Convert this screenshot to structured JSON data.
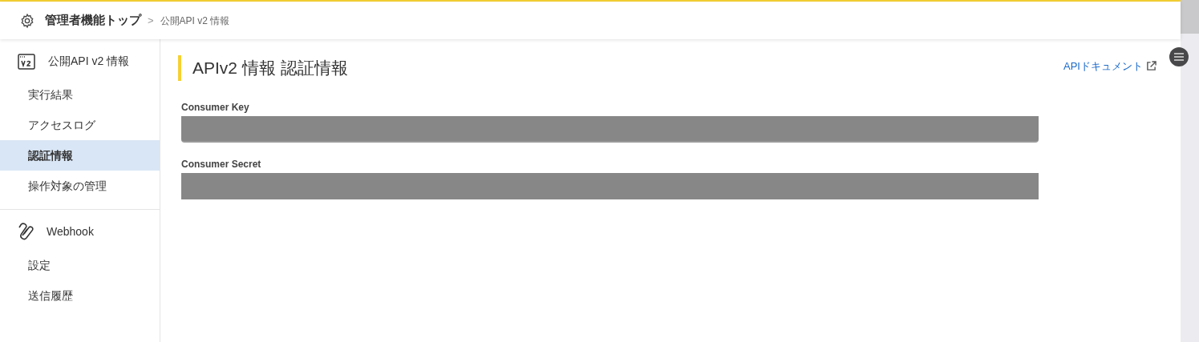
{
  "breadcrumb": {
    "home": "管理者機能トップ",
    "separator": ">",
    "current": "公開API v2 情報"
  },
  "sidebar": {
    "sections": [
      {
        "kind": "api",
        "title": "公開API v2 情報",
        "items": [
          {
            "label": "実行結果",
            "selected": false
          },
          {
            "label": "アクセスログ",
            "selected": false
          },
          {
            "label": "認証情報",
            "selected": true
          },
          {
            "label": "操作対象の管理",
            "selected": false
          }
        ]
      },
      {
        "kind": "webhook",
        "title": "Webhook",
        "items": [
          {
            "label": "設定",
            "selected": false
          },
          {
            "label": "送信履歴",
            "selected": false
          }
        ]
      }
    ]
  },
  "page": {
    "title": "APIv2 情報 認証情報",
    "doc_link": "APIドキュメント"
  },
  "fields": [
    {
      "label": "Consumer Key",
      "redacted": true
    },
    {
      "label": "Consumer Secret",
      "redacted": true
    }
  ]
}
